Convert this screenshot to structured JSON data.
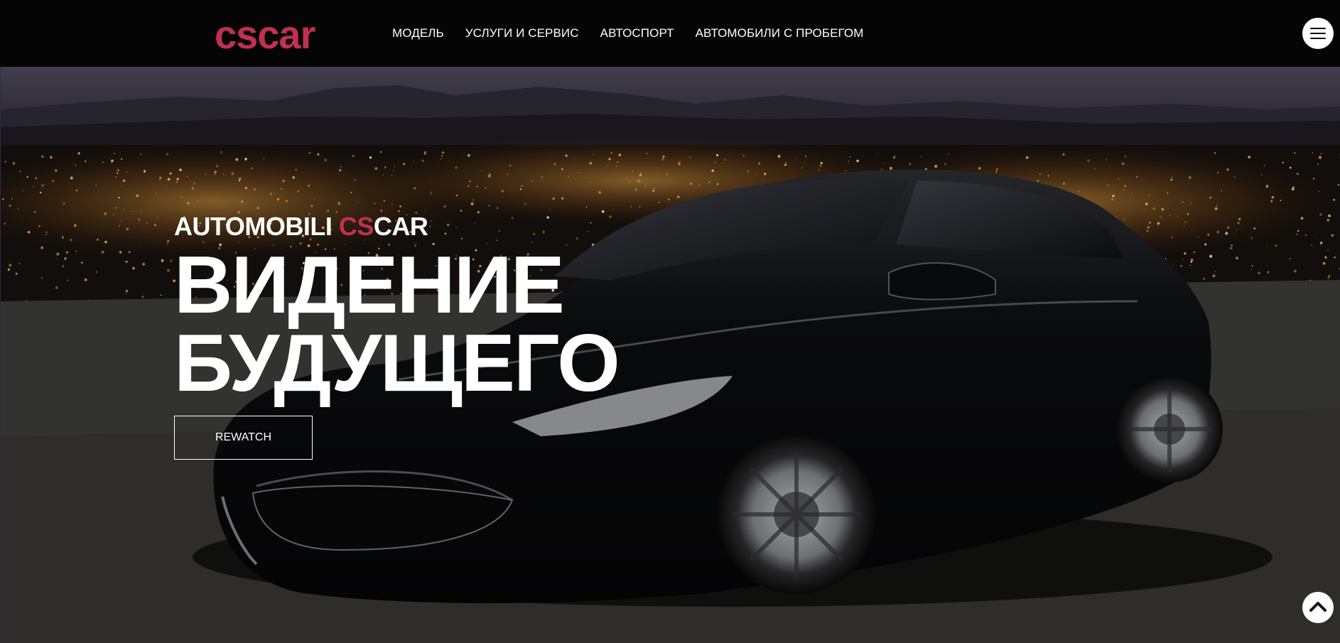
{
  "brand": {
    "logo_text": "cscar",
    "logo_color": "#c0304f"
  },
  "nav": {
    "items": [
      {
        "label": "МОДЕЛЬ"
      },
      {
        "label": "УСЛУГИ И СЕРВИС"
      },
      {
        "label": "АВТОСПОРТ"
      },
      {
        "label": "АВТОМОБИЛИ С ПРОБЕГОМ"
      }
    ]
  },
  "hero": {
    "subtitle_prefix": "AUTOMOBILI ",
    "subtitle_accent": "CS",
    "subtitle_suffix": "CAR",
    "accent_color": "#c0304f",
    "title_line1": "ВИДЕНИЕ",
    "title_line2": "БУДУЩЕГО",
    "button_label": "REWATCH",
    "image": "black sedan parked on an overlook above city lights at dusk"
  },
  "icons": {
    "menu": "hamburger-menu-icon",
    "scroll_top": "chevron-up-icon"
  },
  "colors": {
    "header_bg": "#050505",
    "text": "#ffffff"
  }
}
